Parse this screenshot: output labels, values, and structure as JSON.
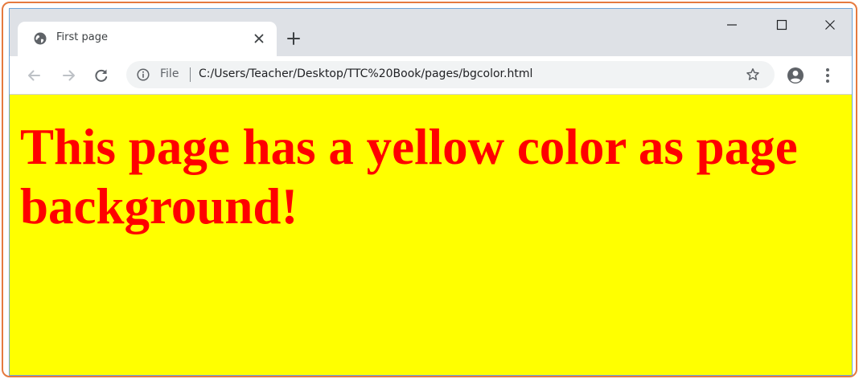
{
  "browser": {
    "tab": {
      "title": "First page",
      "favicon": "globe-icon"
    },
    "toolbar": {
      "scheme_label": "File",
      "url": "C:/Users/Teacher/Desktop/TTC%20Book/pages/bgcolor.html"
    }
  },
  "page": {
    "heading": "This page has a yellow color as page background!",
    "background_color": "#ffff00",
    "text_color": "#ff0000"
  },
  "icons": {
    "tab_favicon": "globe-icon",
    "tab_close": "close-icon",
    "new_tab": "plus-icon",
    "minimize": "minimize-icon",
    "maximize": "maximize-icon",
    "window_close": "close-icon",
    "back": "arrow-left-icon",
    "forward": "arrow-right-icon",
    "reload": "reload-icon",
    "info": "info-icon",
    "bookmark": "star-icon",
    "account": "account-icon",
    "menu": "more-vertical-icon"
  }
}
